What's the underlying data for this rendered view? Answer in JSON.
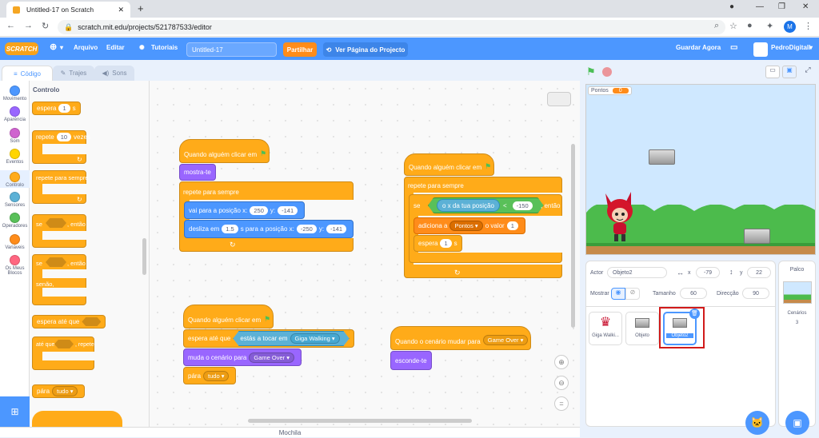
{
  "browser": {
    "tab_title": "Untitled-17 on Scratch",
    "url": "scratch.mit.edu/projects/521787533/editor",
    "profile_initial": "M"
  },
  "menu": {
    "logo": "SCRATCH",
    "file": "Arquivo",
    "edit": "Editar",
    "tutorials": "Tutoriais",
    "project_title": "Untitled-17",
    "share": "Partilhar",
    "view_page": "Ver Página do Projecto",
    "save_now": "Guardar Agora",
    "username": "PedroDigitall"
  },
  "editor_tabs": {
    "code": "Código",
    "costumes": "Trajes",
    "sounds": "Sons"
  },
  "categories": [
    {
      "label": "Movimento",
      "color": "#4c97ff"
    },
    {
      "label": "Aparência",
      "color": "#9966ff"
    },
    {
      "label": "Som",
      "color": "#cf63cf"
    },
    {
      "label": "Eventos",
      "color": "#ffd500"
    },
    {
      "label": "Controlo",
      "color": "#ffab19"
    },
    {
      "label": "Sensores",
      "color": "#5cb1d6"
    },
    {
      "label": "Operadores",
      "color": "#59c059"
    },
    {
      "label": "Variáveis",
      "color": "#ff8c1a"
    },
    {
      "label": "Os Meus Blocos",
      "color": "#ff6680"
    }
  ],
  "palette": {
    "heading": "Controlo",
    "wait": "espera",
    "wait_val": "1",
    "wait_unit": "s",
    "repeat": "repete",
    "repeat_val": "10",
    "repeat_unit": "vezes",
    "forever": "repete para sempre",
    "if": "se",
    "then": ", então",
    "if2": "se",
    "then2": ", então",
    "else": "senão,",
    "wait_until": "espera até que",
    "repeat_until": "até que",
    "repeat_until2": ", repete",
    "stop": "pára",
    "stop_val": "tudo"
  },
  "script1": {
    "hat": "Quando alguém clicar em",
    "show": "mostra-te",
    "forever": "repete para sempre",
    "goto": "vai para a posição x:",
    "goto_x": "250",
    "goto_y_label": "y:",
    "goto_y": "-141",
    "glide": "desliza em",
    "glide_t": "1.5",
    "glide_mid": "s para a posição x:",
    "glide_x": "-250",
    "glide_y_label": "y:",
    "glide_y": "-141"
  },
  "script2": {
    "hat": "Quando alguém clicar em",
    "forever": "repete para sempre",
    "if": "se",
    "cond": "o x da tua posição",
    "op": "<",
    "cond_val": "-150",
    "then": ", então",
    "change": "adiciona a",
    "var": "Pontos",
    "change_mid": "o valor",
    "change_val": "1",
    "wait": "espera",
    "wait_val": "1",
    "wait_unit": "s"
  },
  "script3": {
    "hat": "Quando alguém clicar em",
    "wait_until": "espera até que",
    "touching": "estás a tocar em",
    "touch_target": "Giga Walking",
    "switch": "muda o cenário para",
    "backdrop": "Game Over",
    "stop": "pára",
    "stop_val": "tudo"
  },
  "script4": {
    "hat": "Quando o cenário mudar para",
    "backdrop": "Game Over",
    "hide": "esconde-te"
  },
  "stage": {
    "var_name": "Pontos",
    "var_value": "0"
  },
  "sprite_info": {
    "actor_label": "Actor",
    "actor": "Objeto2",
    "x_label": "x",
    "x": "-79",
    "y_label": "y",
    "y": "22",
    "show_label": "Mostrar",
    "size_label": "Tamanho",
    "size": "60",
    "direction_label": "Direcção",
    "direction": "90"
  },
  "sprites": [
    "Giga Walki...",
    "Objeto",
    "Objeto2"
  ],
  "backdrops": {
    "heading": "Palco",
    "label": "Cenários",
    "count": "3"
  },
  "backpack": "Mochila"
}
